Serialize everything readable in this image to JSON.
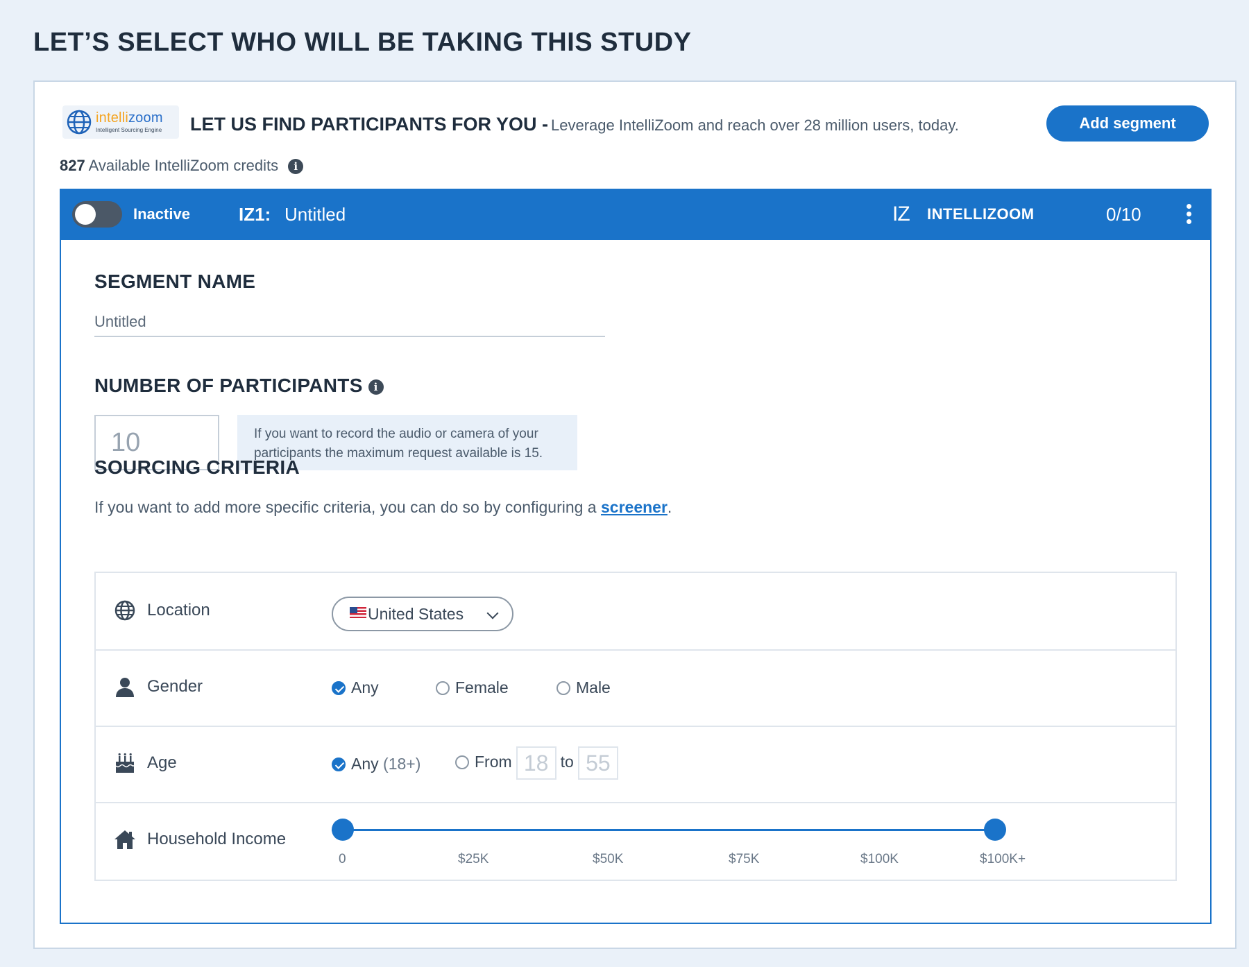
{
  "page": {
    "title": "LET’S SELECT WHO WILL BE TAKING THIS STUDY"
  },
  "logo": {
    "brand_prefix": "intelli",
    "brand_suffix": "zoom",
    "tagline": "Intelligent Sourcing Engine"
  },
  "header": {
    "title": "LET US FIND PARTICIPANTS FOR YOU -",
    "subtitle": "Leverage IntelliZoom and reach over 28 million users, today.",
    "add_segment_label": "Add segment"
  },
  "credits": {
    "count": "827",
    "label": "Available IntelliZoom credits"
  },
  "segment": {
    "status_label": "Inactive",
    "active": false,
    "id": "IZ1:",
    "name": "Untitled",
    "provider_mark": "IZ",
    "provider_label": "INTELLIZOOM",
    "progress": "0/10",
    "segment_name_title": "SEGMENT NAME",
    "segment_name_value": "Untitled",
    "participants_title": "NUMBER OF PARTICIPANTS",
    "participants_value": "10",
    "participants_note": "If you want to record the audio or camera of your participants the maximum request available is 15.",
    "criteria_title": "SOURCING CRITERIA",
    "criteria_text": "If you want to add more specific criteria, you can do so by configuring a",
    "criteria_link": "screener",
    "criteria_period": "."
  },
  "criteria": {
    "location": {
      "label": "Location",
      "selected": "United States"
    },
    "gender": {
      "label": "Gender",
      "options": [
        "Any",
        "Female",
        "Male"
      ],
      "selected": "Any"
    },
    "age": {
      "label": "Age",
      "any_label": "Any",
      "any_sub": "(18+)",
      "from_label": "From",
      "from_value": "18",
      "to_label": "to",
      "to_value": "55"
    },
    "income": {
      "label": "Household Income",
      "ticks": [
        "0",
        "$25K",
        "$50K",
        "$75K",
        "$100K",
        "$100K+"
      ],
      "range_min": "0",
      "range_max": "$100K+"
    }
  },
  "colors": {
    "accent": "#1a73c9",
    "background": "#eaf1f9"
  }
}
